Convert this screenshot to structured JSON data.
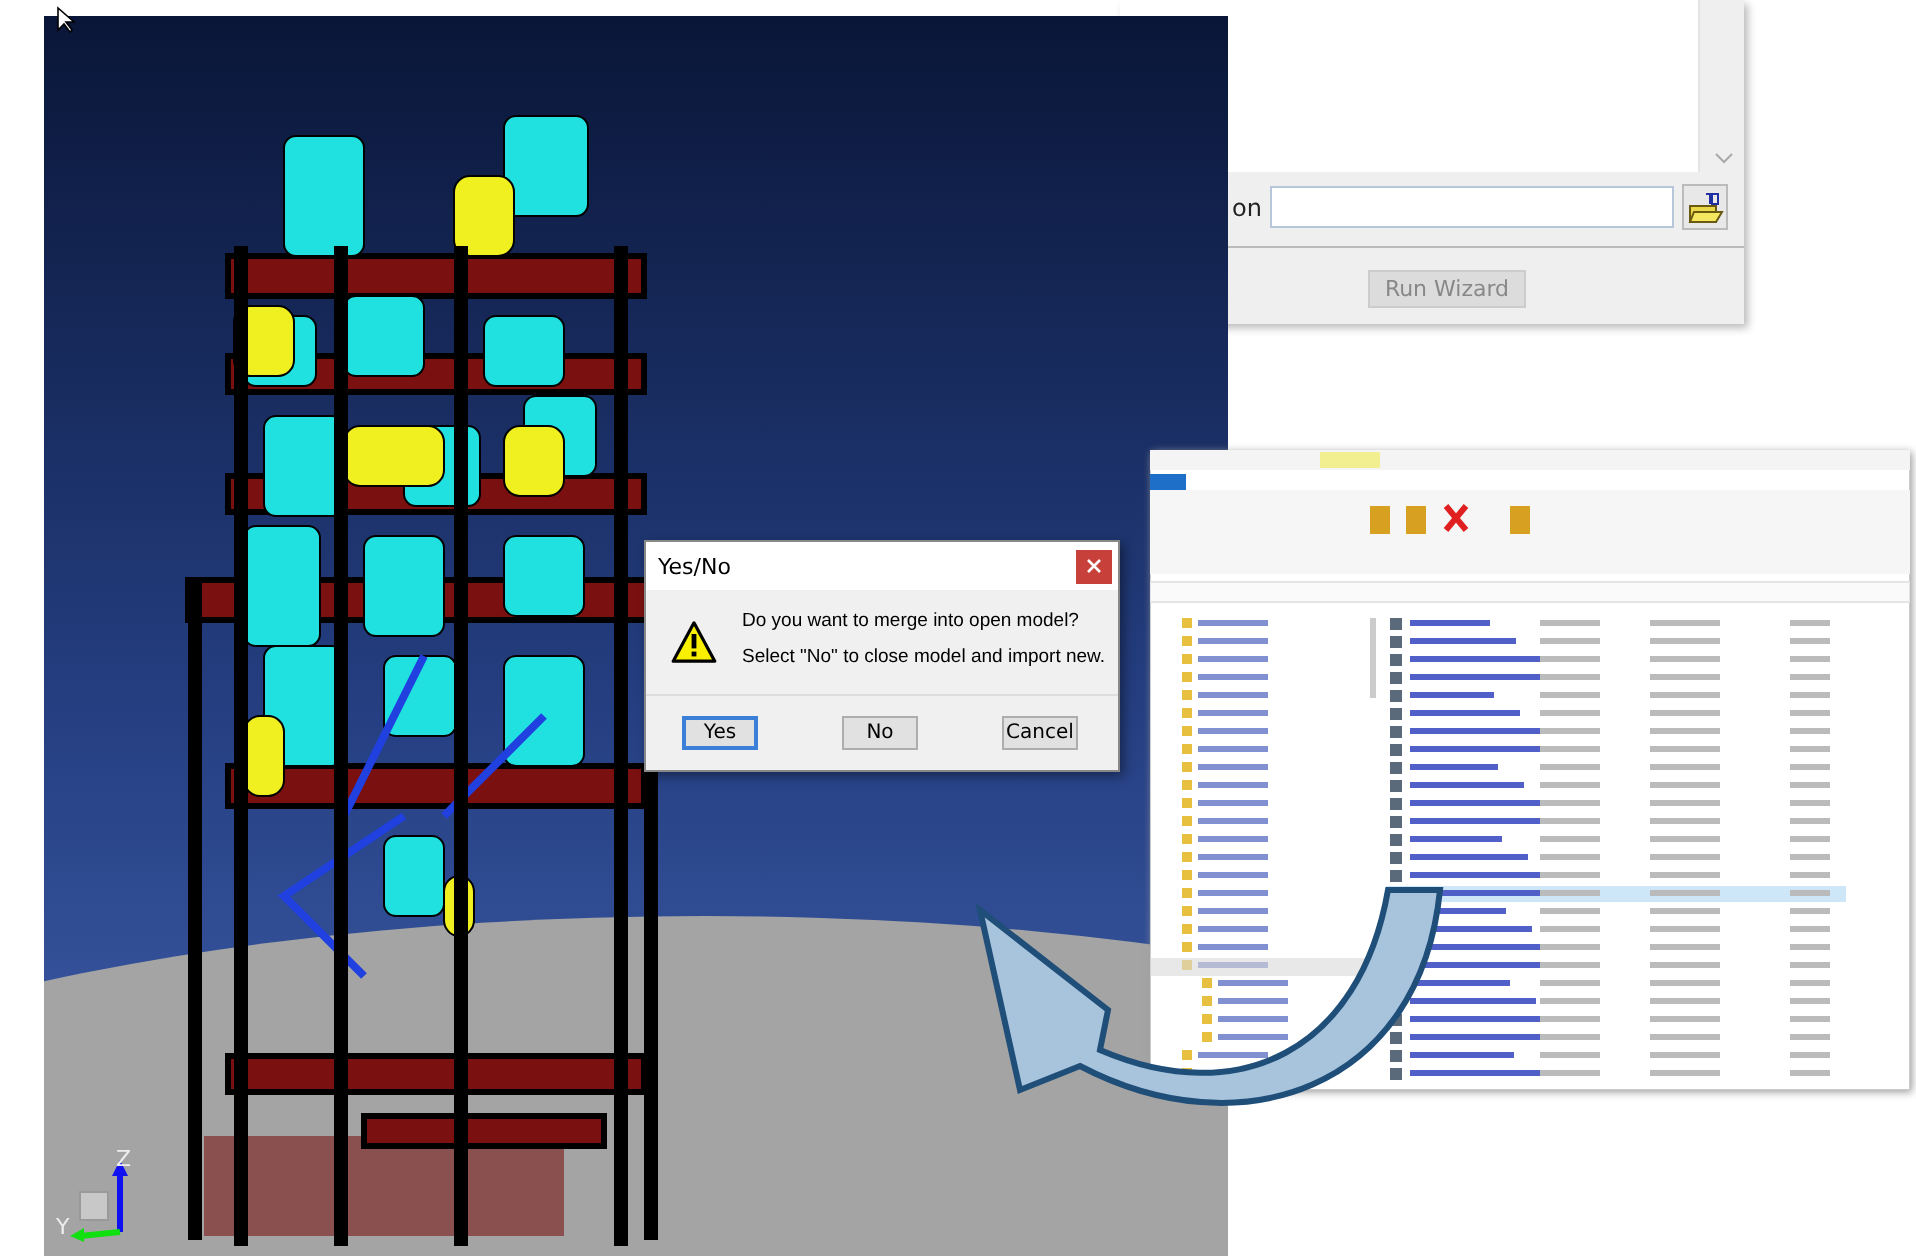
{
  "wizard_window": {
    "field_label": "on",
    "run_button": {
      "label": "Run Wizard",
      "disabled": true
    }
  },
  "viewport": {
    "axis_labels": [
      "Z",
      "Y"
    ]
  },
  "dialog": {
    "title": "Yes/No",
    "messages": [
      "Do you want to merge into open model?",
      "Select \"No\" to close model and import new."
    ],
    "buttons": [
      {
        "label": "Yes",
        "selected": true
      },
      {
        "label": "No",
        "selected": false
      },
      {
        "label": "Cancel",
        "selected": false
      }
    ]
  }
}
